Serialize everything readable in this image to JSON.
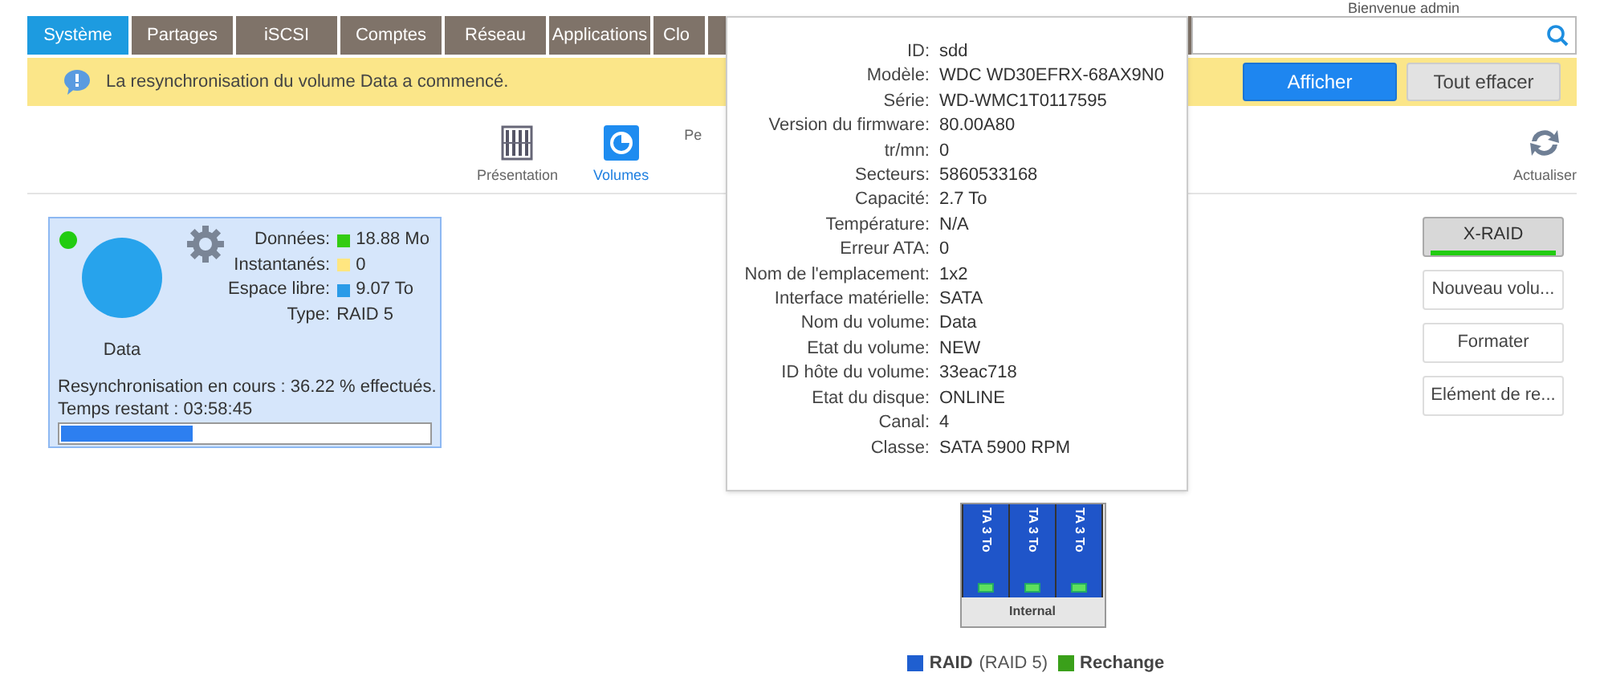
{
  "header": {
    "welcome": "Bienvenue admin"
  },
  "tabs": [
    {
      "label": "Système",
      "selected": true
    },
    {
      "label": "Partages",
      "selected": false
    },
    {
      "label": "iSCSI",
      "selected": false
    },
    {
      "label": "Comptes",
      "selected": false
    },
    {
      "label": "Réseau",
      "selected": false
    },
    {
      "label": "Applications",
      "selected": false
    },
    {
      "label": "Clo",
      "selected": false
    }
  ],
  "notification": {
    "message": "La resynchronisation du volume Data a commencé.",
    "buttons": [
      {
        "label": "Afficher",
        "kind": "primary"
      },
      {
        "label": "Tout effacer",
        "kind": "secondary"
      }
    ]
  },
  "subnav": [
    {
      "label": "Présentation",
      "kind": "overview",
      "selected": false
    },
    {
      "label": "Volumes",
      "kind": "volumes",
      "selected": true
    },
    {
      "label": "Pe",
      "kind": "hidden",
      "selected": false
    }
  ],
  "refresh": {
    "label": "Actualiser"
  },
  "volume": {
    "name": "Data",
    "online": true,
    "stats": [
      {
        "label": "Données:",
        "value": "18.88 Mo",
        "color": "#33cc11"
      },
      {
        "label": "Instantanés:",
        "value": "0",
        "color": "#ffe680"
      },
      {
        "label": "Espace libre:",
        "value": "9.07 To",
        "color": "#2a9be8"
      },
      {
        "label": "Type:",
        "value": "RAID 5"
      }
    ],
    "resync": "Resynchronisation en cours : 36.22 % effectués.",
    "remaining": "Temps restant : 03:58:45",
    "level": 0.36
  },
  "side_buttons": [
    {
      "label": "X-RAID",
      "kind": "xraid",
      "level": 1
    },
    {
      "label": "Nouveau volu...",
      "kind": "plain"
    },
    {
      "label": "Formater",
      "kind": "plain"
    },
    {
      "label": "Elément de re...",
      "kind": "plain"
    }
  ],
  "disk_tooltip": [
    {
      "label": "ID:",
      "value": "sdd"
    },
    {
      "label": "Modèle:",
      "value": "WDC WD30EFRX-68AX9N0"
    },
    {
      "label": "Série:",
      "value": "WD-WMC1T0117595"
    },
    {
      "label": "Version du firmware:",
      "value": "80.00A80"
    },
    {
      "label": "tr/mn:",
      "value": "0"
    },
    {
      "label": "Secteurs:",
      "value": "5860533168"
    },
    {
      "label": "Capacité:",
      "value": "2.7 To"
    },
    {
      "label": "Température:",
      "value": "N/A"
    },
    {
      "label": "Erreur ATA:",
      "value": "0"
    },
    {
      "label": "Nom de l'emplacement:",
      "value": "1x2"
    },
    {
      "label": "Interface matérielle:",
      "value": "SATA"
    },
    {
      "label": "Nom du volume:",
      "value": "Data"
    },
    {
      "label": "Etat du volume:",
      "value": "NEW"
    },
    {
      "label": "ID hôte du volume:",
      "value": "33eac718"
    },
    {
      "label": "Etat du disque:",
      "value": "ONLINE"
    },
    {
      "label": "Canal:",
      "value": "4"
    },
    {
      "label": "Classe:",
      "value": "SATA 5900 RPM"
    }
  ],
  "enclosure": {
    "bays": [
      {
        "label": "TA 3 To",
        "color": "#1f55c9"
      },
      {
        "label": "TA 3 To",
        "color": "#1f55c9"
      },
      {
        "label": "TA 3 To",
        "color": "#1f55c9"
      }
    ],
    "name": "Internal"
  },
  "legend": [
    {
      "label": "RAID",
      "detail": "(RAID 5)",
      "color": "#1f5fd0"
    },
    {
      "label": "Rechange",
      "color": "#3aa01a"
    }
  ]
}
